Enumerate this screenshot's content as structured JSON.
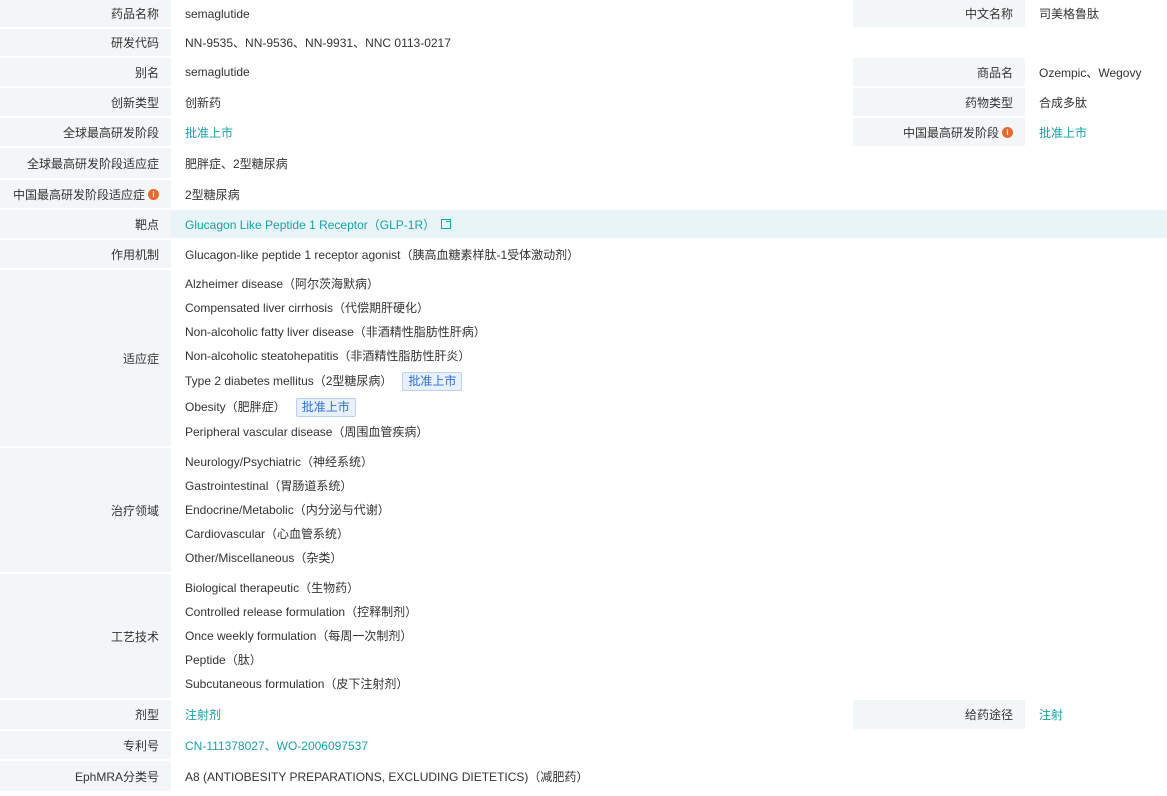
{
  "labels": {
    "drug_name": "药品名称",
    "chinese_name": "中文名称",
    "dev_code": "研发代码",
    "alias": "别名",
    "brand_name": "商品名",
    "innovation_type": "创新类型",
    "drug_type": "药物类型",
    "global_phase": "全球最高研发阶段",
    "china_phase": "中国最高研发阶段",
    "global_indication": "全球最高研发阶段适应症",
    "china_indication": "中国最高研发阶段适应症",
    "target": "靶点",
    "mechanism": "作用机制",
    "indications": "适应症",
    "therapeutic_area": "治疗领域",
    "technology": "工艺技术",
    "dosage_form": "剂型",
    "route": "给药途径",
    "patent": "专利号",
    "ephmra": "EphMRA分类号"
  },
  "values": {
    "drug_name": "semaglutide",
    "chinese_name": "司美格鲁肽",
    "dev_code": "NN-9535、NN-9536、NN-9931、NNC 0113-0217",
    "alias": "semaglutide",
    "brand_name": "Ozempic、Wegovy",
    "innovation_type": "创新药",
    "drug_type": "合成多肽",
    "global_phase": "批准上市",
    "china_phase": "批准上市",
    "global_indication": "肥胖症、2型糖尿病",
    "china_indication": "2型糖尿病",
    "target": "Glucagon Like Peptide 1 Receptor（GLP-1R）",
    "mechanism": "Glucagon-like peptide 1 receptor agonist（胰高血糖素样肽-1受体激动剂）",
    "indications": [
      {
        "text": "Alzheimer disease（阿尔茨海默病）",
        "tag": ""
      },
      {
        "text": "Compensated liver cirrhosis（代偿期肝硬化）",
        "tag": ""
      },
      {
        "text": "Non-alcoholic fatty liver disease（非酒精性脂肪性肝病）",
        "tag": ""
      },
      {
        "text": "Non-alcoholic steatohepatitis（非酒精性脂肪性肝炎）",
        "tag": ""
      },
      {
        "text": "Type 2 diabetes mellitus（2型糖尿病）",
        "tag": "批准上市"
      },
      {
        "text": "Obesity（肥胖症）",
        "tag": "批准上市"
      },
      {
        "text": "Peripheral vascular disease（周围血管疾病）",
        "tag": ""
      }
    ],
    "therapeutic_areas": [
      "Neurology/Psychiatric（神经系统）",
      "Gastrointestinal（胃肠道系统）",
      "Endocrine/Metabolic（内分泌与代谢）",
      "Cardiovascular（心血管系统）",
      "Other/Miscellaneous（杂类）"
    ],
    "technologies": [
      "Biological therapeutic（生物药）",
      "Controlled release formulation（控释制剂）",
      "Once weekly formulation（每周一次制剂）",
      "Peptide（肽）",
      "Subcutaneous formulation（皮下注射剂）"
    ],
    "dosage_form": "注射剂",
    "route": "注射",
    "patent": "CN-111378027、WO-2006097537",
    "ephmra": "A8 (ANTIOBESITY PREPARATIONS, EXCLUDING DIETETICS)（减肥药）"
  },
  "icons": {
    "info": "info-icon",
    "external_link": "external-link-icon"
  },
  "colors": {
    "label_bg": "#f2f6f7",
    "link": "#18a0a8",
    "tag_text": "#2f6fd0",
    "tag_bg": "#e7f0fc",
    "info_icon": "#e8692f"
  }
}
